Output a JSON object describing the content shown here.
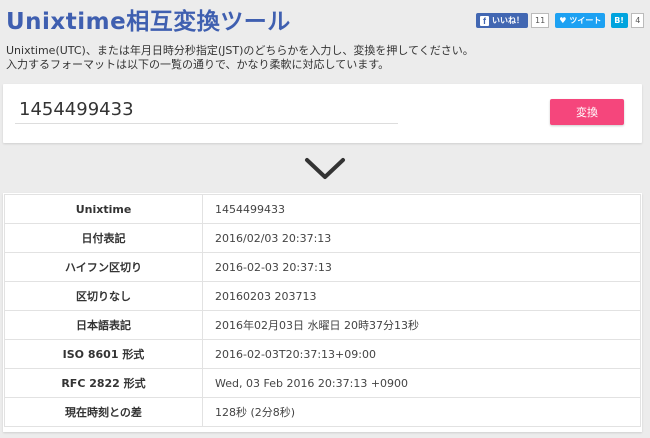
{
  "header": {
    "title": "Unixtime相互変換ツール",
    "social": {
      "facebook_label": "いいね！",
      "facebook_logo": "f",
      "facebook_count": "11",
      "twitter_label": "ツイート",
      "hatena_label": "B!",
      "hatena_count": "4"
    }
  },
  "description": {
    "line1": "Unixtime(UTC)、または年月日時分秒指定(JST)のどちらかを入力し、変換を押してください。",
    "line2": "入力するフォーマットは以下の一覧の通りで、かなり柔軟に対応しています。"
  },
  "converter": {
    "input_value": "1454499433",
    "button_label": "変換"
  },
  "results": [
    {
      "label": "Unixtime",
      "value": "1454499433"
    },
    {
      "label": "日付表記",
      "value": "2016/02/03 20:37:13"
    },
    {
      "label": "ハイフン区切り",
      "value": "2016-02-03 20:37:13"
    },
    {
      "label": "区切りなし",
      "value": "20160203 203713"
    },
    {
      "label": "日本語表記",
      "value": "2016年02月03日 水曜日 20時37分13秒"
    },
    {
      "label": "ISO 8601 形式",
      "value": "2016-02-03T20:37:13+09:00"
    },
    {
      "label": "RFC 2822 形式",
      "value": "Wed, 03 Feb 2016 20:37:13 +0900"
    },
    {
      "label": "現在時刻との差",
      "value": "128秒 (2分8秒)"
    }
  ],
  "colors": {
    "title": "#3f5fb0",
    "button": "#f5467c",
    "facebook": "#4267b2",
    "twitter": "#1da1f2",
    "hatena": "#00a4de"
  }
}
